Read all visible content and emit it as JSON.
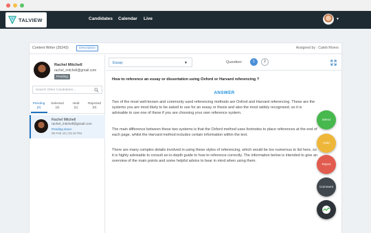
{
  "nav": {
    "brand": "TALVIEW",
    "items": [
      "Candidates",
      "Calendar",
      "Live"
    ]
  },
  "header": {
    "role": "Content Writer (35243)",
    "description_btn": "Description",
    "assigned": "Assigned by : Caleb Rivers"
  },
  "candidate": {
    "name": "Rachel Mitchell",
    "email": "rachel_mitchell@gmail.com",
    "status": "Pending"
  },
  "search": {
    "placeholder": "Search Other Candidates..."
  },
  "tabs": [
    {
      "label": "Pending",
      "count": "(2)"
    },
    {
      "label": "Selected",
      "count": "(4)"
    },
    {
      "label": "Held",
      "count": "(1)"
    },
    {
      "label": "Rejected",
      "count": "(0)"
    }
  ],
  "list": [
    {
      "name": "Rachel Mitchell",
      "email": "rachel_mitchell@gmail.com",
      "since": "Pending since:",
      "time": "05 Feb 16 | 03:10 PM"
    }
  ],
  "question": {
    "type": "Essay",
    "label": "Question:",
    "numbers": [
      "1",
      "2"
    ],
    "text": "How to reference an essay or dissertation using Oxford or Harvard referencing ?",
    "answer_heading": "ANSWER",
    "answer": [
      "Two of the most well-known and commonly used referencing methods are Oxford and Harvard referencing. These are the systems you are most likely to be asked to use for an essay or thesis and also the most widely recognised, so it is advisable to use one of these if you are choosing your own reference system.",
      "The main difference between these two systems is that the Oxford method uses footnotes to place references at the end of each page, whilst the Harvard method includes certain information within the text.",
      "There are many complex details involved in using these styles of referencing, which would be too numerous to list here, so it is highly advisable to consult an in-depth guide to how to reference correctly. The information below is intended to give an overview of the main points and some helpful advice to bear in mind when using them."
    ]
  },
  "actions": {
    "select": "Select",
    "hold": "Hold",
    "reject": "Reject",
    "comment": "Comment"
  },
  "colors": {
    "navbar": "#1f2b33",
    "accent": "#1e73be",
    "select": "#46b84d",
    "hold": "#efb73a",
    "reject": "#e25b4f",
    "comment": "#40474d"
  }
}
